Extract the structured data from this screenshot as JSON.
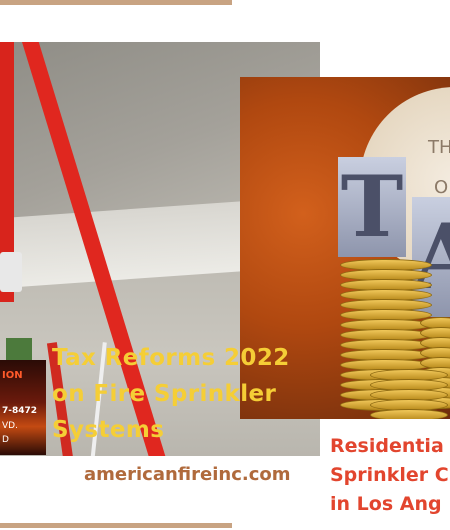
{
  "post_left": {
    "title": "Tax Reforms 2022 on Fire Sprinkler Systems",
    "site": "americanfireinc.com",
    "thumbnail": {
      "line1": "ION",
      "line2": "7-8472",
      "line3": "VD.",
      "line4": "D"
    }
  },
  "post_right": {
    "title_line1": "Residentia",
    "title_line2": "Sprinkler C",
    "title_line3": "in Los Ang",
    "block_letter_1": "T",
    "block_letter_2": "A",
    "clock_text_1": "TH",
    "clock_text_2": "O"
  },
  "colors": {
    "accent_bar": "#c8a382",
    "title_yellow": "#f5ce36",
    "site_brown": "#b06a3c",
    "caption_red": "#e2452e"
  }
}
